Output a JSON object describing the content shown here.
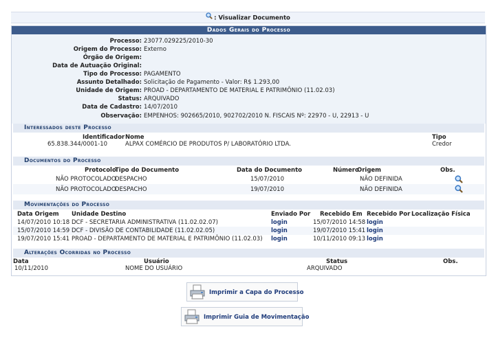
{
  "legend": {
    "text": ": Visualizar Documento"
  },
  "main_header": "Dados Gerais do Processo",
  "general": [
    {
      "label": "Processo:",
      "value": "23077.029225/2010-30"
    },
    {
      "label": "Origem do Processo:",
      "value": "Externo"
    },
    {
      "label": "Órgão de Origem:",
      "value": ""
    },
    {
      "label": "Data de Autuação Original:",
      "value": ""
    },
    {
      "label": "Tipo do Processo:",
      "value": "PAGAMENTO"
    },
    {
      "label": "Assunto Detalhado:",
      "value": "Solicitação de Pagamento - Valor: R$ 1.293,00"
    },
    {
      "label": "Unidade de Origem:",
      "value": "PROAD - DEPARTAMENTO DE MATERIAL E PATRIMÔNIO (11.02.03)"
    },
    {
      "label": "Status:",
      "value": "ARQUIVADO"
    },
    {
      "label": "Data de Cadastro:",
      "value": "14/07/2010"
    },
    {
      "label": "Observação:",
      "value": "EMPENHOS: 902665/2010, 902702/2010 N. FISCAIS Nº: 22970 - U, 22913 - U"
    }
  ],
  "interessados": {
    "title": "Interessados deste Processo",
    "headers": {
      "identificador": "Identificador",
      "nome": "Nome",
      "tipo": "Tipo"
    },
    "rows": [
      {
        "identificador": "65.838.344/0001-10",
        "nome": "ALPAX COMÉRCIO DE PRODUTOS P/ LABORATÓRIO LTDA.",
        "tipo": "Credor"
      }
    ]
  },
  "documentos": {
    "title": "Documentos do Processo",
    "headers": {
      "protocolo": "Protocolo",
      "tipo": "Tipo do Documento",
      "data": "Data do Documento",
      "numero": "Número",
      "origem": "Origem",
      "obs": "Obs."
    },
    "rows": [
      {
        "protocolo": "NÃO PROTOCOLADO",
        "tipo": "DESPACHO",
        "data": "15/07/2010",
        "numero": "",
        "origem": "NÃO DEFINIDA"
      },
      {
        "protocolo": "NÃO PROTOCOLADO",
        "tipo": "DESPACHO",
        "data": "19/07/2010",
        "numero": "",
        "origem": "NÃO DEFINIDA"
      }
    ]
  },
  "movimentacoes": {
    "title": "Movimentações do Processo",
    "headers": {
      "data_origem": "Data Origem",
      "unidade": "Unidade Destino",
      "enviado": "Enviado Por",
      "recebido_em": "Recebido Em",
      "recebido_por": "Recebido Por",
      "localizacao": "Localização Física"
    },
    "rows": [
      {
        "data_origem": "14/07/2010 10:18",
        "unidade": "DCF - SECRETARIA ADMINISTRATIVA (11.02.02.07)",
        "enviado": "login",
        "recebido_em": "15/07/2010 14:58",
        "recebido_por": "login",
        "localizacao": ""
      },
      {
        "data_origem": "15/07/2010 14:59",
        "unidade": "DCF - DIVISÃO DE CONTABILIDADE (11.02.02.05)",
        "enviado": "login",
        "recebido_em": "19/07/2010 15:41",
        "recebido_por": "login",
        "localizacao": ""
      },
      {
        "data_origem": "19/07/2010 15:41",
        "unidade": "PROAD - DEPARTAMENTO DE MATERIAL E PATRIMÔNIO (11.02.03)",
        "enviado": "login",
        "recebido_em": "10/11/2010 09:13",
        "recebido_por": "login",
        "localizacao": ""
      }
    ]
  },
  "alteracoes": {
    "title": "Alterações Ocorridas no Processo",
    "headers": {
      "data": "Data",
      "usuario": "Usuário",
      "status": "Status",
      "obs": "Obs."
    },
    "rows": [
      {
        "data": "10/11/2010",
        "usuario": "NOME DO USUÁRIO",
        "status": "ARQUIVADO",
        "obs": ""
      }
    ]
  },
  "buttons": {
    "print_cover": "Imprimir a Capa do Processo",
    "print_guide": "Imprimir Guia de Movimentação"
  },
  "icons": {
    "view": "magnifier-icon",
    "print": "printer-icon"
  },
  "colors": {
    "header_bg": "#3d5c8c",
    "subheader_bg": "#e3e9f3",
    "subheader_text": "#23406e",
    "link": "#1e3b7a"
  }
}
